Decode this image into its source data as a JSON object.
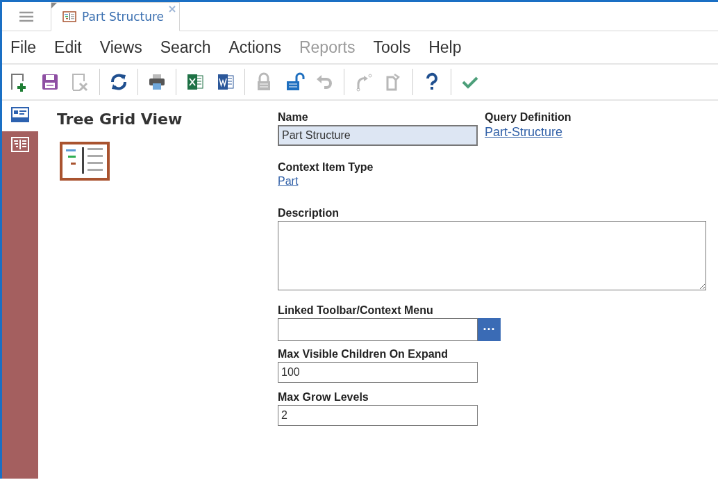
{
  "tabs": [
    {
      "label": "Part Structure",
      "selected": true
    }
  ],
  "menu": [
    {
      "label": "File",
      "disabled": false
    },
    {
      "label": "Edit",
      "disabled": false
    },
    {
      "label": "Views",
      "disabled": false
    },
    {
      "label": "Search",
      "disabled": false
    },
    {
      "label": "Actions",
      "disabled": false
    },
    {
      "label": "Reports",
      "disabled": true
    },
    {
      "label": "Tools",
      "disabled": false
    },
    {
      "label": "Help",
      "disabled": false
    }
  ],
  "toolbar": [
    {
      "buttons": [
        {
          "kind": "new",
          "disabled": false
        },
        {
          "kind": "save",
          "disabled": false
        },
        {
          "kind": "delete",
          "disabled": true
        }
      ]
    },
    {
      "buttons": [
        {
          "kind": "refresh",
          "disabled": false
        }
      ]
    },
    {
      "buttons": [
        {
          "kind": "print",
          "disabled": false
        }
      ]
    },
    {
      "buttons": [
        {
          "kind": "excel",
          "disabled": false
        },
        {
          "kind": "word",
          "disabled": false
        }
      ]
    },
    {
      "buttons": [
        {
          "kind": "lock",
          "disabled": true
        },
        {
          "kind": "unlock",
          "disabled": false
        },
        {
          "kind": "undo",
          "disabled": true
        }
      ]
    },
    {
      "buttons": [
        {
          "kind": "redo",
          "disabled": true
        },
        {
          "kind": "paste",
          "disabled": true
        }
      ]
    },
    {
      "buttons": [
        {
          "kind": "help",
          "disabled": false
        }
      ]
    },
    {
      "buttons": [
        {
          "kind": "done",
          "disabled": false
        }
      ]
    }
  ],
  "sidebar": {
    "items": [
      {
        "kind": "form",
        "selected": true
      },
      {
        "kind": "tree",
        "selected": false
      }
    ]
  },
  "form": {
    "title": "Tree Grid View",
    "name": {
      "label": "Name",
      "value": "Part Structure",
      "highlighted": true
    },
    "query_definition": {
      "label": "Query Definition",
      "link": "Part-Structure"
    },
    "context_item_type": {
      "label": "Context Item Type",
      "link": "Part"
    },
    "description": {
      "label": "Description"
    },
    "linked_toolbar": {
      "label": "Linked Toolbar/Context Menu",
      "button": "···"
    },
    "max_visible_children": {
      "label": "Max Visible Children On Expand",
      "value": "100"
    },
    "max_grow_levels": {
      "label": "Max Grow Levels",
      "value": "2"
    }
  }
}
